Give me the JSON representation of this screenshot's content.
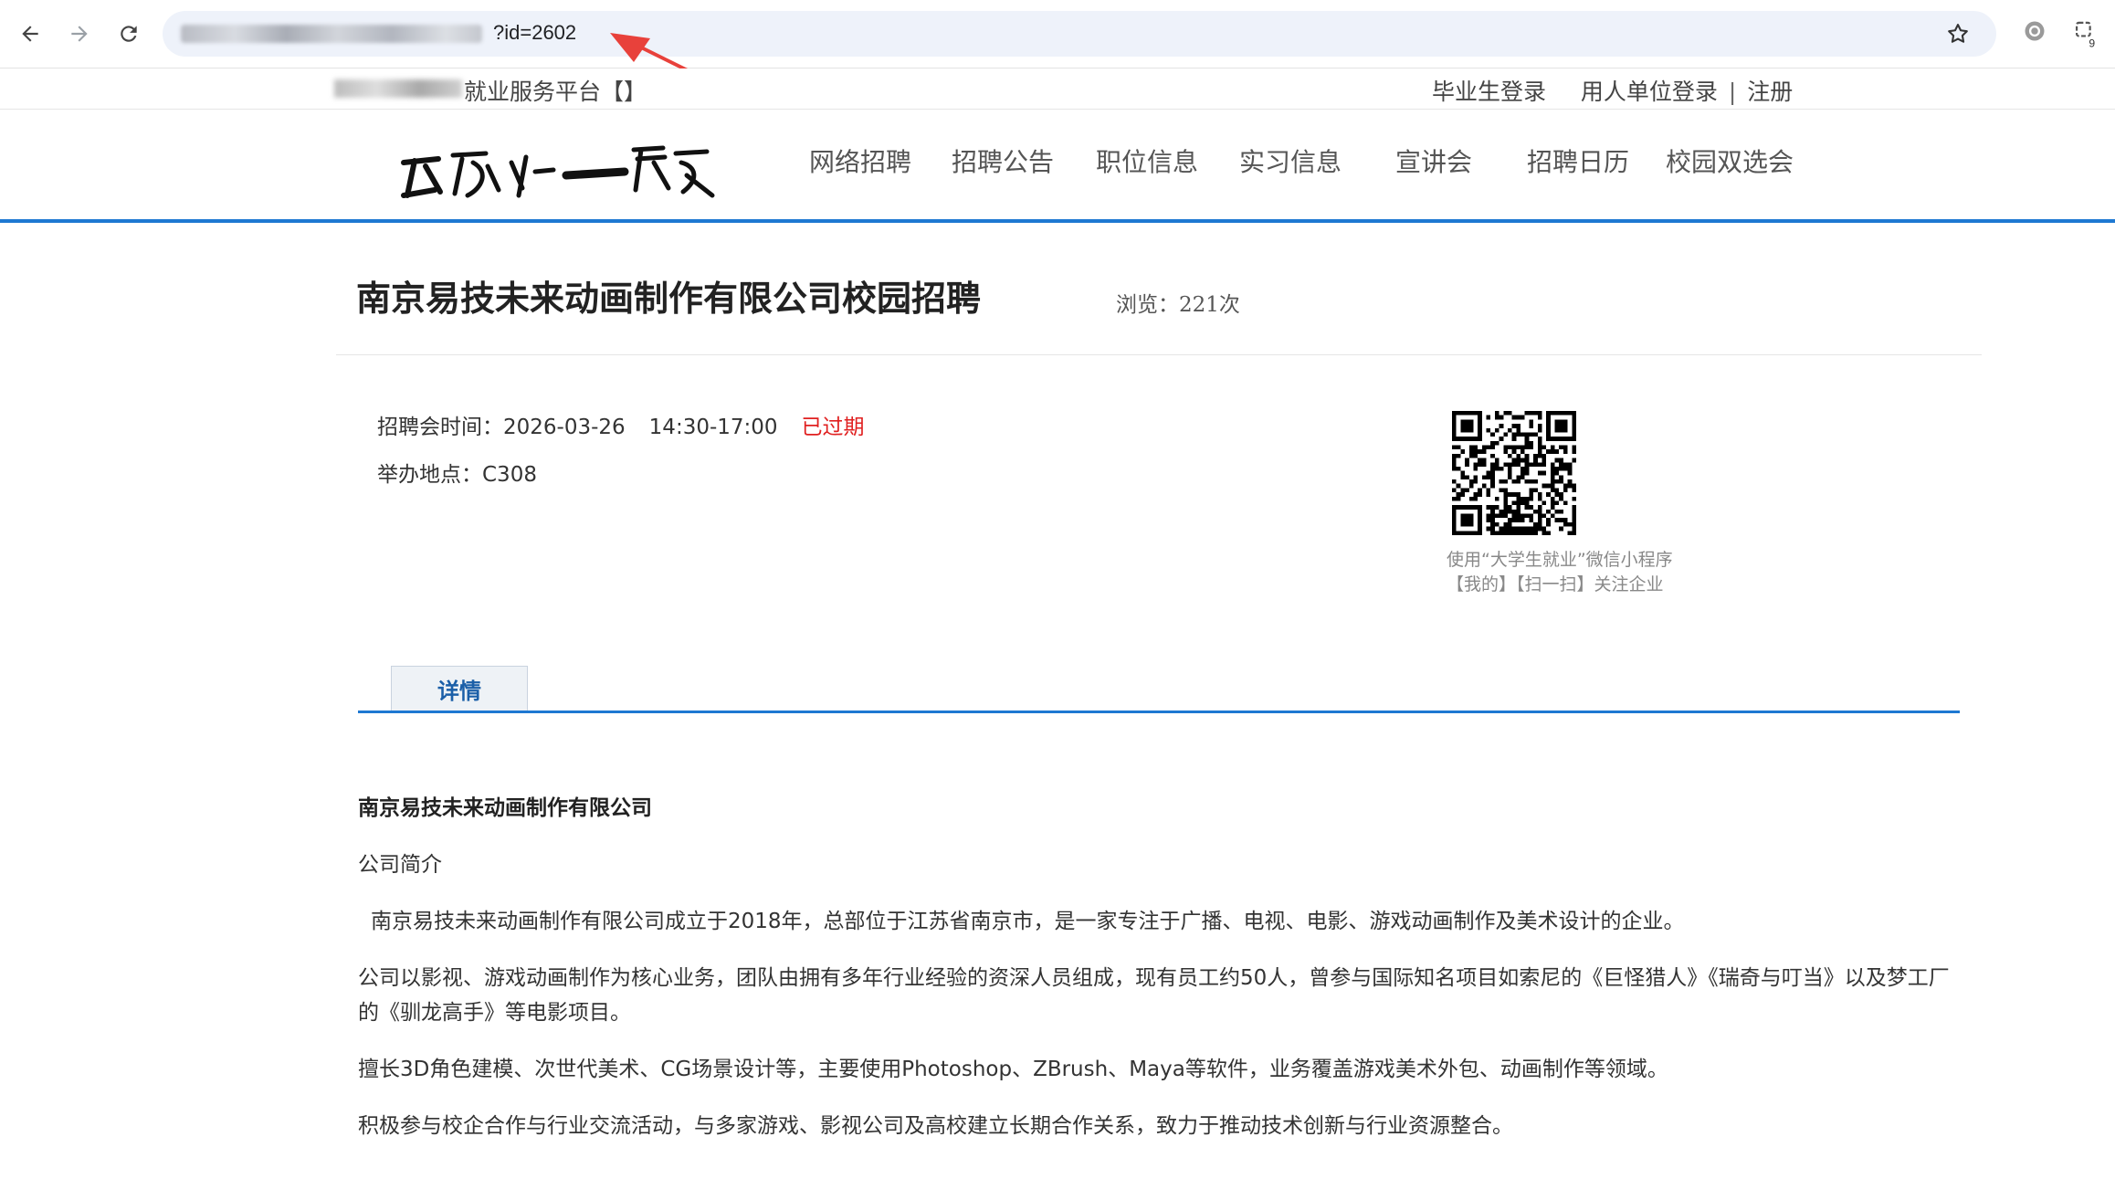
{
  "browser": {
    "url_tail": "?id=2602"
  },
  "topbar": {
    "platform_name": "就业服务平台【】",
    "links": {
      "graduate_login": "毕业生登录",
      "employer_login": "用人单位登录",
      "separator": "|",
      "register": "注册"
    }
  },
  "nav": {
    "items": [
      "网络招聘",
      "招聘公告",
      "职位信息",
      "实习信息",
      "宣讲会",
      "招聘日历",
      "校园双选会"
    ]
  },
  "event": {
    "title": "南京易技未来动画制作有限公司校园招聘",
    "views": "浏览：221次",
    "time_label": "招聘会时间：",
    "date": "2026-03-26",
    "time": "14:30-17:00",
    "status": "已过期",
    "location_label": "举办地点：",
    "location": "C308",
    "qr_caption_line1": "使用“大学生就业”微信小程序",
    "qr_caption_line2": "【我的】【扫一扫】关注企业"
  },
  "tabs": {
    "details": "详情"
  },
  "content": {
    "company_name": "南京易技未来动画制作有限公司",
    "intro_heading": "公司简介",
    "paragraphs": [
      "南京易技未来动画制作有限公司成立于2018年，总部位于江苏省南京市，是一家专注于广播、电视、电影、游戏动画制作及美术设计的企业。",
      "公司以影视、游戏动画制作为核心业务，团队由拥有多年行业经验的资深人员组成，现有员工约50人，曾参与国际知名项目如索尼的《巨怪猎人》《瑞奇与叮当》以及梦工厂的《驯龙高手》等电影项目。",
      "擅长3D角色建模、次世代美术、CG场景设计等，主要使用Photoshop、ZBrush、Maya等软件，业务覆盖游戏美术外包、动画制作等领域。",
      "积极参与校企合作与行业交流活动，与多家游戏、影视公司及高校建立长期合作关系，致力于推动技术创新与行业资源整合。"
    ]
  },
  "colors": {
    "accent": "#1e78d2",
    "expired": "#e02020",
    "tab_text": "#1b5fa8"
  },
  "icons": [
    "back-arrow-icon",
    "forward-arrow-icon",
    "reload-icon",
    "bookmark-star-icon",
    "extension-icon",
    "tab-search-icon",
    "annotation-arrow-icon",
    "qr-code-icon"
  ]
}
